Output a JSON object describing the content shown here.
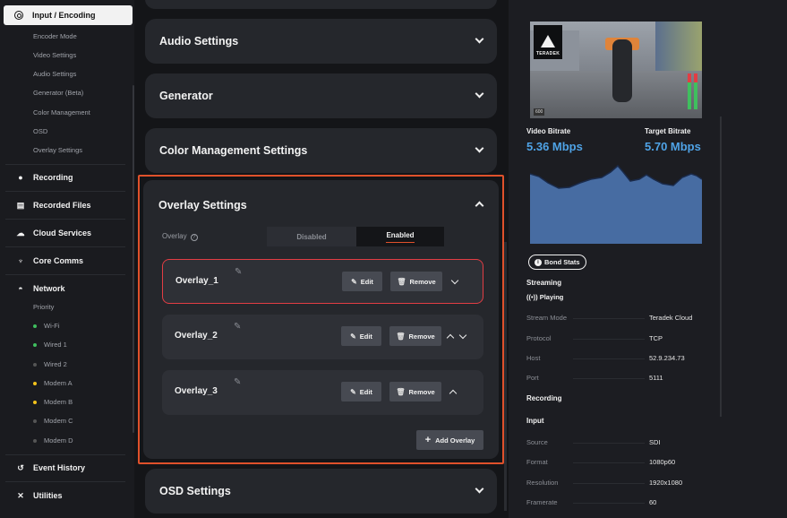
{
  "sidebar": {
    "active_item": "Input / Encoding",
    "input_sub_items": [
      "Encoder Mode",
      "Video Settings",
      "Audio Settings",
      "Generator (Beta)",
      "Color Management",
      "OSD",
      "Overlay Settings"
    ],
    "recording": "Recording",
    "recorded_files": "Recorded Files",
    "cloud_services": "Cloud Services",
    "core_comms": "Core Comms",
    "network": "Network",
    "network_sub": {
      "priority": "Priority",
      "items": [
        {
          "label": "Wi-Fi",
          "status": "green"
        },
        {
          "label": "Wired 1",
          "status": "green"
        },
        {
          "label": "Wired 2",
          "status": "gray"
        },
        {
          "label": "Modem A",
          "status": "yellow"
        },
        {
          "label": "Modem B",
          "status": "yellow"
        },
        {
          "label": "Modem C",
          "status": "gray"
        },
        {
          "label": "Modem D",
          "status": "gray"
        }
      ]
    },
    "event_history": "Event History",
    "utilities": "Utilities"
  },
  "panels": {
    "audio": "Audio Settings",
    "generator": "Generator",
    "color": "Color Management Settings",
    "overlay": "Overlay Settings",
    "osd": "OSD Settings"
  },
  "overlay": {
    "toggle_label": "Overlay",
    "help_glyph": "?",
    "disabled": "Disabled",
    "enabled": "Enabled",
    "items": [
      {
        "name": "Overlay_1"
      },
      {
        "name": "Overlay_2"
      },
      {
        "name": "Overlay_3"
      }
    ],
    "edit_label": "Edit",
    "remove_label": "Remove",
    "add_label": "Add Overlay"
  },
  "preview": {
    "logo_text": "TERADEK",
    "res_tag": "600"
  },
  "stats": {
    "video_bitrate_label": "Video Bitrate",
    "video_bitrate": "5.36 Mbps",
    "target_bitrate_label": "Target Bitrate",
    "target_bitrate": "5.70 Mbps",
    "bond_stats": "Bond Stats",
    "streaming": "Streaming",
    "playing": "Playing",
    "stream_rows": [
      {
        "key": "Stream Mode",
        "value": "Teradek Cloud"
      },
      {
        "key": "Protocol",
        "value": "TCP"
      },
      {
        "key": "Host",
        "value": "52.9.234.73"
      },
      {
        "key": "Port",
        "value": "5111"
      }
    ],
    "recording": "Recording",
    "input": "Input",
    "input_rows": [
      {
        "key": "Source",
        "value": "SDI"
      },
      {
        "key": "Format",
        "value": "1080p60"
      },
      {
        "key": "Resolution",
        "value": "1920x1080"
      },
      {
        "key": "Framerate",
        "value": "60"
      }
    ]
  },
  "colors": {
    "accent": "#e0512b",
    "bitrate_blue": "#4fa3e6",
    "selected_border": "#e23d44"
  }
}
